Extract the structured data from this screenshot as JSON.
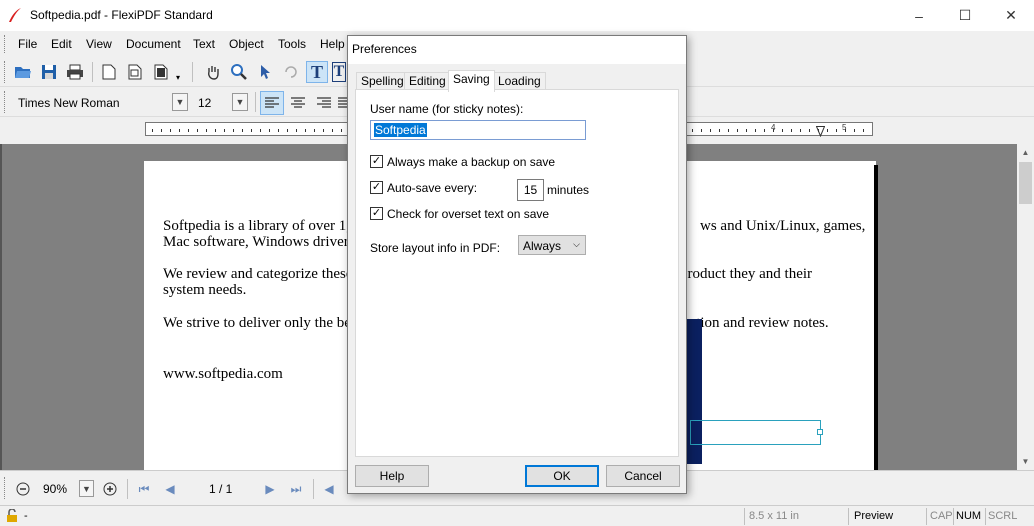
{
  "window": {
    "title": "Softpedia.pdf - FlexiPDF Standard",
    "minimize": "–",
    "maximize": "☐",
    "close": "✕"
  },
  "menu": [
    "File",
    "Edit",
    "View",
    "Document",
    "Text",
    "Object",
    "Tools",
    "Help"
  ],
  "format": {
    "font": "Times New Roman",
    "size": "12"
  },
  "ruler": {
    "labels": [
      "4",
      "5"
    ]
  },
  "document": {
    "lines": [
      "Softpedia is a library of over 1,0",
      "Mac software, Windows drivers",
      "We review and categorize these",
      "system needs.",
      "We strive to deliver only the bes",
      "www.softpedia.com"
    ],
    "right_fragments": [
      "ws and Unix/Linux, games,",
      "product they and their",
      "uation and review notes."
    ]
  },
  "nav": {
    "zoom": "90%",
    "page": "1 / 1"
  },
  "status": {
    "lock": "-",
    "size": "8.5 x 11 in",
    "mode": "Preview",
    "cap": "CAP",
    "num": "NUM",
    "scrl": "SCRL"
  },
  "dialog": {
    "title": "Preferences",
    "tabs": [
      "Spelling",
      "Editing",
      "Saving",
      "Loading"
    ],
    "active_tab": "Saving",
    "username_label": "User name (for sticky notes):",
    "username_value": "Softpedia",
    "backup_label": "Always make a backup on save",
    "backup_checked": true,
    "autosave_label": "Auto-save every:",
    "autosave_checked": true,
    "autosave_value": "15",
    "autosave_unit": "minutes",
    "overset_label": "Check for overset text on save",
    "overset_checked": true,
    "layout_label": "Store layout info in PDF:",
    "layout_value": "Always",
    "help_button": "Help",
    "ok_button": "OK",
    "cancel_button": "Cancel"
  }
}
